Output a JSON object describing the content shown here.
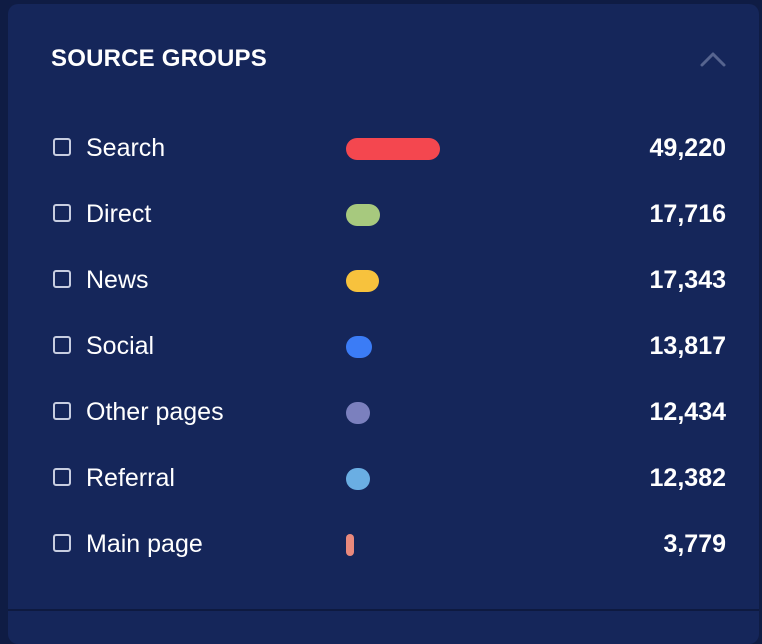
{
  "panel": {
    "title": "SOURCE GROUPS",
    "collapse_icon": "chevron-up-icon"
  },
  "colors": {
    "background": "#15265a",
    "text": "#ffffff"
  },
  "groups": [
    {
      "label": "Search",
      "value": "49,220",
      "count": 49220,
      "color": "#f4474f",
      "checked": false
    },
    {
      "label": "Direct",
      "value": "17,716",
      "count": 17716,
      "color": "#a7c97e",
      "checked": false
    },
    {
      "label": "News",
      "value": "17,343",
      "count": 17343,
      "color": "#f7c23d",
      "checked": false
    },
    {
      "label": "Social",
      "value": "13,817",
      "count": 13817,
      "color": "#3b7cf6",
      "checked": false
    },
    {
      "label": "Other pages",
      "value": "12,434",
      "count": 12434,
      "color": "#7b80be",
      "checked": false
    },
    {
      "label": "Referral",
      "value": "12,382",
      "count": 12382,
      "color": "#6aaee3",
      "checked": false
    },
    {
      "label": "Main page",
      "value": "3,779",
      "count": 3779,
      "color": "#e9897c",
      "checked": false
    }
  ]
}
